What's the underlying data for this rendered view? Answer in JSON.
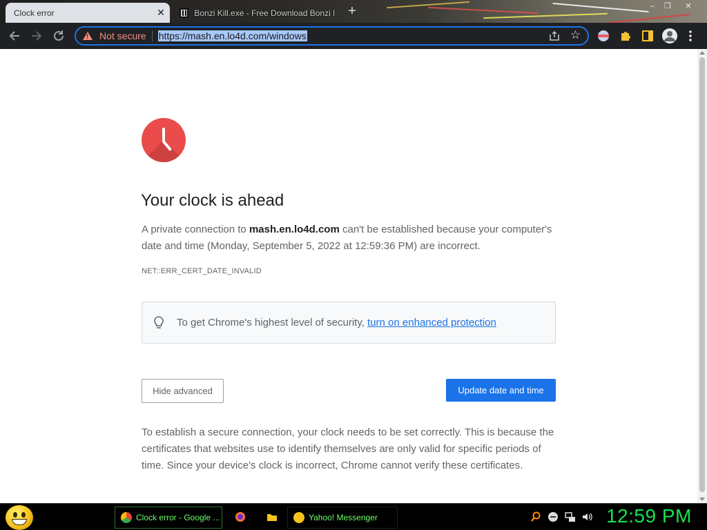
{
  "browser": {
    "tabs": [
      {
        "title": "Clock error",
        "active": true
      },
      {
        "title": "Bonzi Kill.exe - Free Download Bonzi Kill",
        "active": false
      }
    ],
    "close_tab_label": "✕",
    "new_tab_label": "+",
    "security_label": "Not secure",
    "url": "https://mash.en.lo4d.com/windows",
    "icons": {
      "back": "back-arrow-icon",
      "forward": "forward-arrow-icon",
      "reload": "reload-icon",
      "share": "share-icon",
      "bookmark": "star-icon",
      "extensions": "puzzle-icon",
      "sidepanel": "side-panel-icon",
      "profile": "profile-icon",
      "menu": "kebab-menu-icon"
    }
  },
  "page": {
    "heading": "Your clock is ahead",
    "explanation_prefix": "A private connection to ",
    "explanation_domain": "mash.en.lo4d.com",
    "explanation_suffix": " can't be established because your computer's date and time (Monday, September 5, 2022 at 12:59:36 PM) are incorrect.",
    "error_code": "NET::ERR_CERT_DATE_INVALID",
    "enhanced_text": "To get Chrome's highest level of security, ",
    "enhanced_link": "turn on enhanced protection",
    "hide_advanced_label": "Hide advanced",
    "update_label": "Update date and time",
    "details": "To establish a secure connection, your clock needs to be set correctly. This is because the certificates that websites use to identify themselves are only valid for specific periods of time. Since your device's clock is incorrect, Chrome cannot verify these certificates.",
    "colors": {
      "accent": "#1a73e8",
      "clock_icon": "#ea4b4b",
      "not_secure": "#f28b82"
    }
  },
  "taskbar": {
    "items": [
      {
        "label": "Clock error - Google ...",
        "icon": "chrome-icon"
      },
      {
        "label": "Yahoo! Messenger",
        "icon": "yahoo-messenger-icon"
      }
    ],
    "time": "12:59 PM",
    "time_color": "#16e24a"
  }
}
